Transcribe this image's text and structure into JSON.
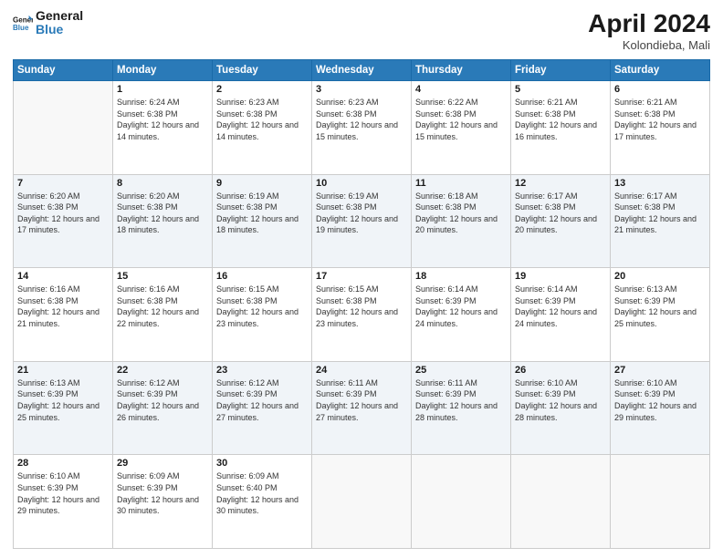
{
  "header": {
    "logo_line1": "General",
    "logo_line2": "Blue",
    "month": "April 2024",
    "location": "Kolondieba, Mali"
  },
  "weekdays": [
    "Sunday",
    "Monday",
    "Tuesday",
    "Wednesday",
    "Thursday",
    "Friday",
    "Saturday"
  ],
  "weeks": [
    [
      {
        "day": "",
        "empty": true
      },
      {
        "day": "1",
        "sunrise": "6:24 AM",
        "sunset": "6:38 PM",
        "daylight": "12 hours and 14 minutes."
      },
      {
        "day": "2",
        "sunrise": "6:23 AM",
        "sunset": "6:38 PM",
        "daylight": "12 hours and 14 minutes."
      },
      {
        "day": "3",
        "sunrise": "6:23 AM",
        "sunset": "6:38 PM",
        "daylight": "12 hours and 15 minutes."
      },
      {
        "day": "4",
        "sunrise": "6:22 AM",
        "sunset": "6:38 PM",
        "daylight": "12 hours and 15 minutes."
      },
      {
        "day": "5",
        "sunrise": "6:21 AM",
        "sunset": "6:38 PM",
        "daylight": "12 hours and 16 minutes."
      },
      {
        "day": "6",
        "sunrise": "6:21 AM",
        "sunset": "6:38 PM",
        "daylight": "12 hours and 17 minutes."
      }
    ],
    [
      {
        "day": "7",
        "sunrise": "6:20 AM",
        "sunset": "6:38 PM",
        "daylight": "12 hours and 17 minutes."
      },
      {
        "day": "8",
        "sunrise": "6:20 AM",
        "sunset": "6:38 PM",
        "daylight": "12 hours and 18 minutes."
      },
      {
        "day": "9",
        "sunrise": "6:19 AM",
        "sunset": "6:38 PM",
        "daylight": "12 hours and 18 minutes."
      },
      {
        "day": "10",
        "sunrise": "6:19 AM",
        "sunset": "6:38 PM",
        "daylight": "12 hours and 19 minutes."
      },
      {
        "day": "11",
        "sunrise": "6:18 AM",
        "sunset": "6:38 PM",
        "daylight": "12 hours and 20 minutes."
      },
      {
        "day": "12",
        "sunrise": "6:17 AM",
        "sunset": "6:38 PM",
        "daylight": "12 hours and 20 minutes."
      },
      {
        "day": "13",
        "sunrise": "6:17 AM",
        "sunset": "6:38 PM",
        "daylight": "12 hours and 21 minutes."
      }
    ],
    [
      {
        "day": "14",
        "sunrise": "6:16 AM",
        "sunset": "6:38 PM",
        "daylight": "12 hours and 21 minutes."
      },
      {
        "day": "15",
        "sunrise": "6:16 AM",
        "sunset": "6:38 PM",
        "daylight": "12 hours and 22 minutes."
      },
      {
        "day": "16",
        "sunrise": "6:15 AM",
        "sunset": "6:38 PM",
        "daylight": "12 hours and 23 minutes."
      },
      {
        "day": "17",
        "sunrise": "6:15 AM",
        "sunset": "6:38 PM",
        "daylight": "12 hours and 23 minutes."
      },
      {
        "day": "18",
        "sunrise": "6:14 AM",
        "sunset": "6:39 PM",
        "daylight": "12 hours and 24 minutes."
      },
      {
        "day": "19",
        "sunrise": "6:14 AM",
        "sunset": "6:39 PM",
        "daylight": "12 hours and 24 minutes."
      },
      {
        "day": "20",
        "sunrise": "6:13 AM",
        "sunset": "6:39 PM",
        "daylight": "12 hours and 25 minutes."
      }
    ],
    [
      {
        "day": "21",
        "sunrise": "6:13 AM",
        "sunset": "6:39 PM",
        "daylight": "12 hours and 25 minutes."
      },
      {
        "day": "22",
        "sunrise": "6:12 AM",
        "sunset": "6:39 PM",
        "daylight": "12 hours and 26 minutes."
      },
      {
        "day": "23",
        "sunrise": "6:12 AM",
        "sunset": "6:39 PM",
        "daylight": "12 hours and 27 minutes."
      },
      {
        "day": "24",
        "sunrise": "6:11 AM",
        "sunset": "6:39 PM",
        "daylight": "12 hours and 27 minutes."
      },
      {
        "day": "25",
        "sunrise": "6:11 AM",
        "sunset": "6:39 PM",
        "daylight": "12 hours and 28 minutes."
      },
      {
        "day": "26",
        "sunrise": "6:10 AM",
        "sunset": "6:39 PM",
        "daylight": "12 hours and 28 minutes."
      },
      {
        "day": "27",
        "sunrise": "6:10 AM",
        "sunset": "6:39 PM",
        "daylight": "12 hours and 29 minutes."
      }
    ],
    [
      {
        "day": "28",
        "sunrise": "6:10 AM",
        "sunset": "6:39 PM",
        "daylight": "12 hours and 29 minutes."
      },
      {
        "day": "29",
        "sunrise": "6:09 AM",
        "sunset": "6:39 PM",
        "daylight": "12 hours and 30 minutes."
      },
      {
        "day": "30",
        "sunrise": "6:09 AM",
        "sunset": "6:40 PM",
        "daylight": "12 hours and 30 minutes."
      },
      {
        "day": "",
        "empty": true
      },
      {
        "day": "",
        "empty": true
      },
      {
        "day": "",
        "empty": true
      },
      {
        "day": "",
        "empty": true
      }
    ]
  ]
}
